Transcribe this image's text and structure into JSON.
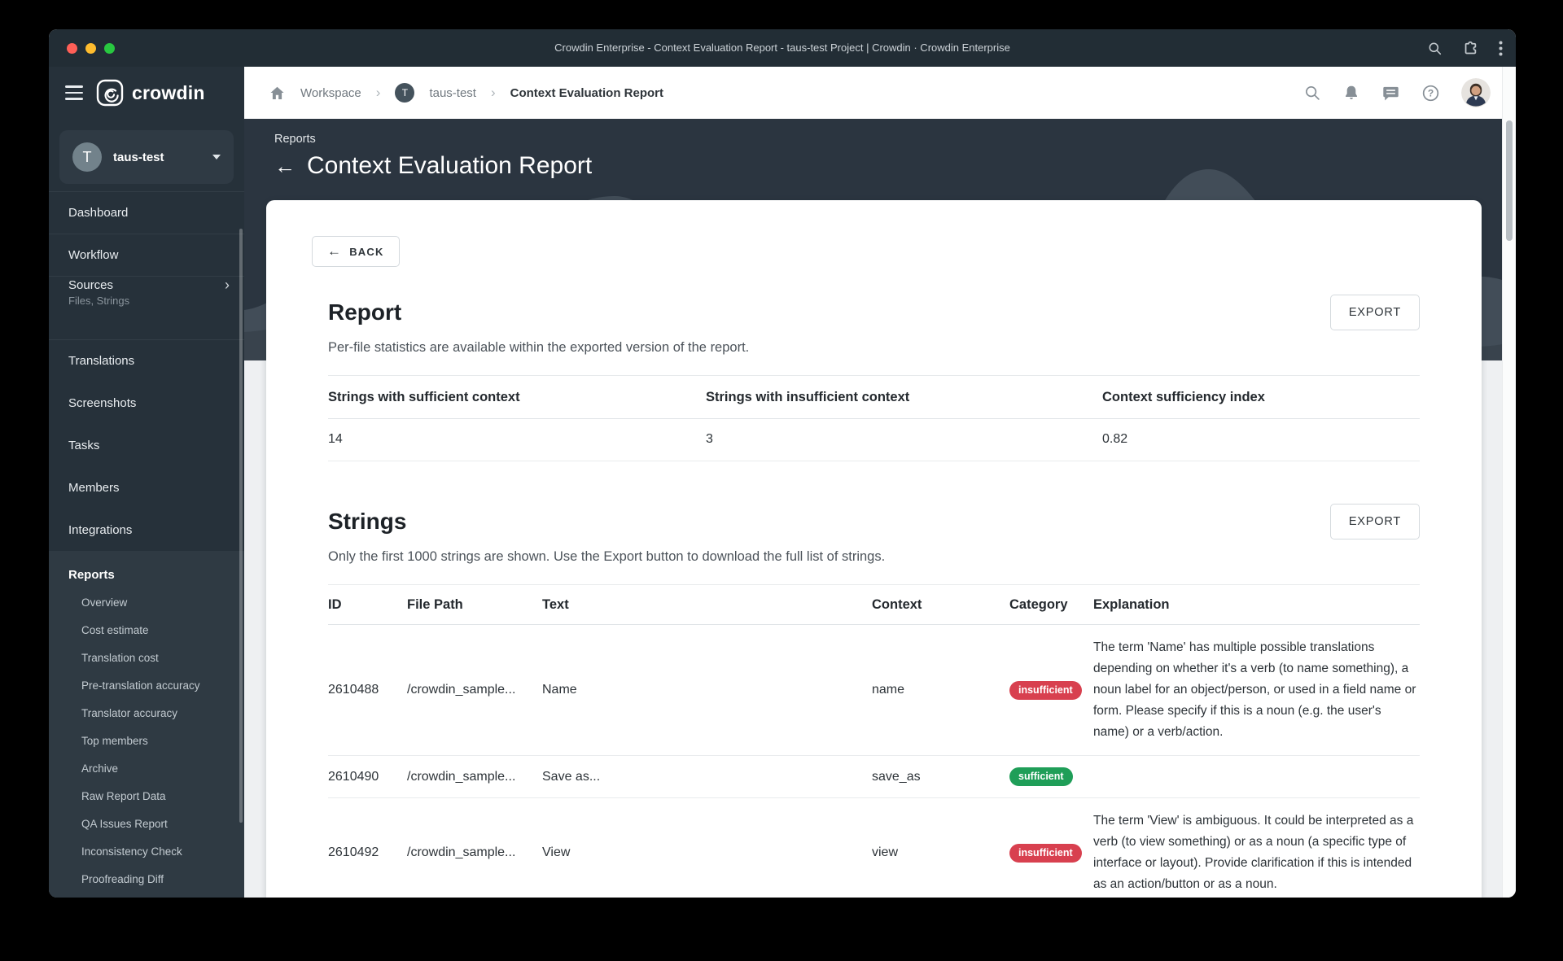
{
  "window": {
    "title": "Crowdin Enterprise - Context Evaluation Report - taus-test Project | Crowdin · Crowdin Enterprise"
  },
  "sidebar": {
    "logo_word": "crowdin",
    "project": {
      "name": "taus-test",
      "initial": "T"
    },
    "items": [
      {
        "label": "Dashboard"
      },
      {
        "label": "Workflow"
      },
      {
        "label": "Sources",
        "sublabel": "Files, Strings",
        "chevron": "›"
      },
      {
        "label": "Translations"
      },
      {
        "label": "Screenshots"
      },
      {
        "label": "Tasks"
      },
      {
        "label": "Members"
      },
      {
        "label": "Integrations"
      }
    ],
    "reports": {
      "label": "Reports",
      "children": [
        {
          "label": "Overview"
        },
        {
          "label": "Cost estimate"
        },
        {
          "label": "Translation cost"
        },
        {
          "label": "Pre-translation accuracy"
        },
        {
          "label": "Translator accuracy"
        },
        {
          "label": "Top members"
        },
        {
          "label": "Archive"
        },
        {
          "label": "Raw Report Data"
        },
        {
          "label": "QA Issues Report"
        },
        {
          "label": "Inconsistency Check"
        },
        {
          "label": "Proofreading Diff"
        }
      ]
    }
  },
  "breadcrumb": {
    "items": [
      "Workspace",
      "taus-test",
      "Context Evaluation Report"
    ],
    "project_initial": "T"
  },
  "page_header": {
    "eyebrow": "Reports",
    "title": "Context Evaluation Report",
    "back_arrow": "←"
  },
  "report": {
    "back_label": "BACK",
    "back_arrow": "←",
    "title": "Report",
    "export_label": "EXPORT",
    "subtitle": "Per-file statistics are available within the exported version of the report.",
    "stats": {
      "headers": [
        "Strings with sufficient context",
        "Strings with insufficient context",
        "Context sufficiency index"
      ],
      "values": [
        "14",
        "3",
        "0.82"
      ]
    }
  },
  "strings_section": {
    "title": "Strings",
    "export_label": "EXPORT",
    "subtitle": "Only the first 1000 strings are shown. Use the Export button to download the full list of strings.",
    "table": {
      "headers": [
        "ID",
        "File Path",
        "Text",
        "Context",
        "Category",
        "Explanation"
      ],
      "rows": [
        {
          "id": "2610488",
          "file_path": "/crowdin_sample...",
          "text": "Name",
          "context": "name",
          "category": "insufficient",
          "explanation": "The term 'Name' has multiple possible translations depending on whether it's a verb (to name something), a noun label for an object/person, or used in a field name or form. Please specify if this is a noun (e.g. the user's name) or a verb/action."
        },
        {
          "id": "2610490",
          "file_path": "/crowdin_sample...",
          "text": "Save as...",
          "context": "save_as",
          "category": "sufficient",
          "explanation": ""
        },
        {
          "id": "2610492",
          "file_path": "/crowdin_sample...",
          "text": "View",
          "context": "view",
          "category": "insufficient",
          "explanation": "The term 'View' is ambiguous. It could be interpreted as a verb (to view something) or as a noun (a specific type of interface or layout). Provide clarification if this is intended as an action/button or as a noun."
        }
      ]
    }
  },
  "colors": {
    "badge_insufficient": "#d8404f",
    "badge_sufficient": "#1f9e58",
    "titlebar_bg": "#222d35",
    "sidebar_bg": "#26313a",
    "header_band_bg": "#2b3540",
    "page_bg": "#eef0f2",
    "traffic_red": "#ff5f57",
    "traffic_yellow": "#febc2e",
    "traffic_green": "#28c840"
  }
}
